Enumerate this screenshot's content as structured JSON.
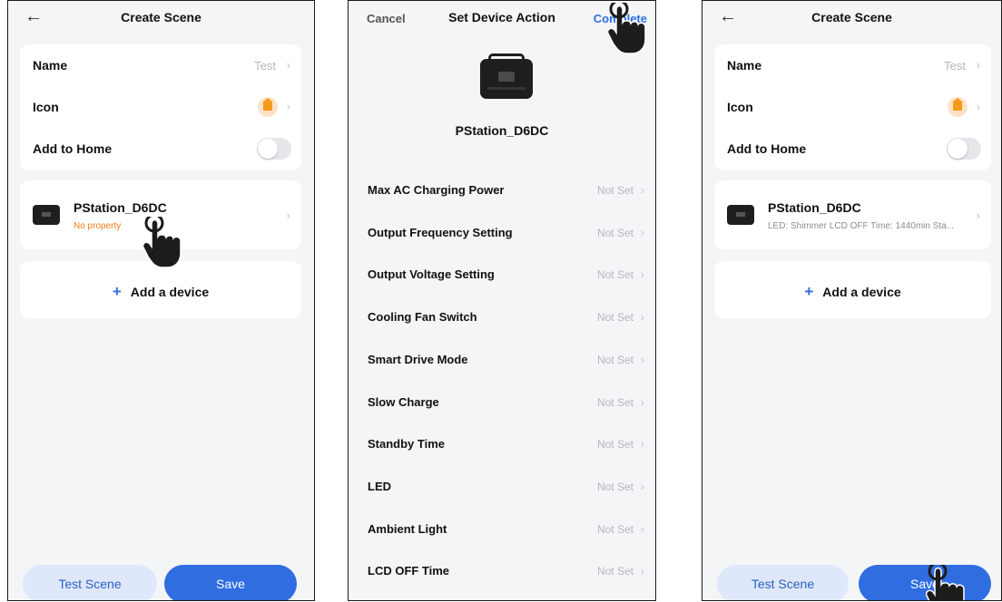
{
  "screen1": {
    "title": "Create Scene",
    "back_icon": "arrow-left-icon",
    "settings": [
      {
        "label": "Name",
        "value": "Test"
      },
      {
        "label": "Icon",
        "icon": "house-icon",
        "icon_color": "#f59a1a"
      },
      {
        "label": "Add to Home",
        "toggle": false
      }
    ],
    "device": {
      "name": "PStation_D6DC",
      "subtitle": "No property",
      "subtitle_color": "#f07c1c"
    },
    "add_device": "Add a device",
    "buttons": {
      "test": "Test Scene",
      "save": "Save"
    }
  },
  "screen2": {
    "cancel": "Cancel",
    "title": "Set Device Action",
    "complete": "Complete",
    "device_name": "PStation_D6DC",
    "actions": [
      {
        "label": "Max AC Charging Power",
        "value": "Not Set"
      },
      {
        "label": "Output Frequency Setting",
        "value": "Not Set"
      },
      {
        "label": "Output Voltage Setting",
        "value": "Not Set"
      },
      {
        "label": "Cooling Fan Switch",
        "value": "Not Set"
      },
      {
        "label": "Smart Drive Mode",
        "value": "Not Set"
      },
      {
        "label": "Slow Charge",
        "value": "Not Set"
      },
      {
        "label": "Standby Time",
        "value": "Not Set"
      },
      {
        "label": "LED",
        "value": "Not Set"
      },
      {
        "label": "Ambient Light",
        "value": "Not Set"
      },
      {
        "label": "LCD OFF Time",
        "value": "Not Set"
      }
    ]
  },
  "screen3": {
    "title": "Create Scene",
    "back_icon": "arrow-left-icon",
    "settings": [
      {
        "label": "Name",
        "value": "Test"
      },
      {
        "label": "Icon",
        "icon": "house-icon"
      },
      {
        "label": "Add to Home",
        "toggle": false
      }
    ],
    "device": {
      "name": "PStation_D6DC",
      "subtitle": "LED: Shimmer LCD OFF Time: 1440min Sta..."
    },
    "add_device": "Add a device",
    "buttons": {
      "test": "Test Scene",
      "save": "Save"
    }
  },
  "colors": {
    "accent": "#2f6de1",
    "warning": "#f07c1c",
    "background": "#f4f5f7"
  }
}
